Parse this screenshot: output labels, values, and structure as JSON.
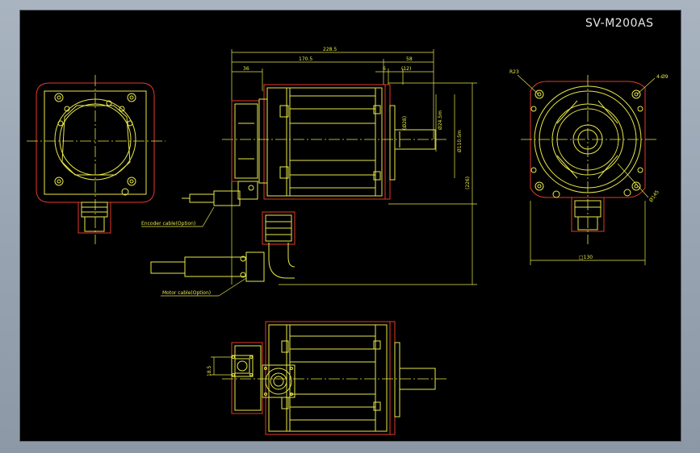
{
  "title": "SV-M200AS",
  "dimensions": {
    "overall_length": "228.5",
    "body_length": "170.5",
    "flange_offset": "36",
    "shaft_length": "58",
    "flange_thickness": "6",
    "shaft_key": "(12)",
    "shaft_dia": "Ø24.5m",
    "pilot_dia": "Ø110.5m",
    "shaft_inner": "(Ø28)",
    "height_total": "(226)",
    "square": "□130",
    "radius": "R23",
    "holes": "4-Ø9",
    "pcd": "Ø145",
    "connector_height": "18.5"
  },
  "labels": {
    "encoder_cable": "Encoder cable(Option)",
    "motor_cable": "Motor cable(Option)"
  },
  "colors": {
    "background": "#000000",
    "outline": "#e23a2a",
    "detail": "#e8e84a",
    "title": "#e6e6e6"
  }
}
